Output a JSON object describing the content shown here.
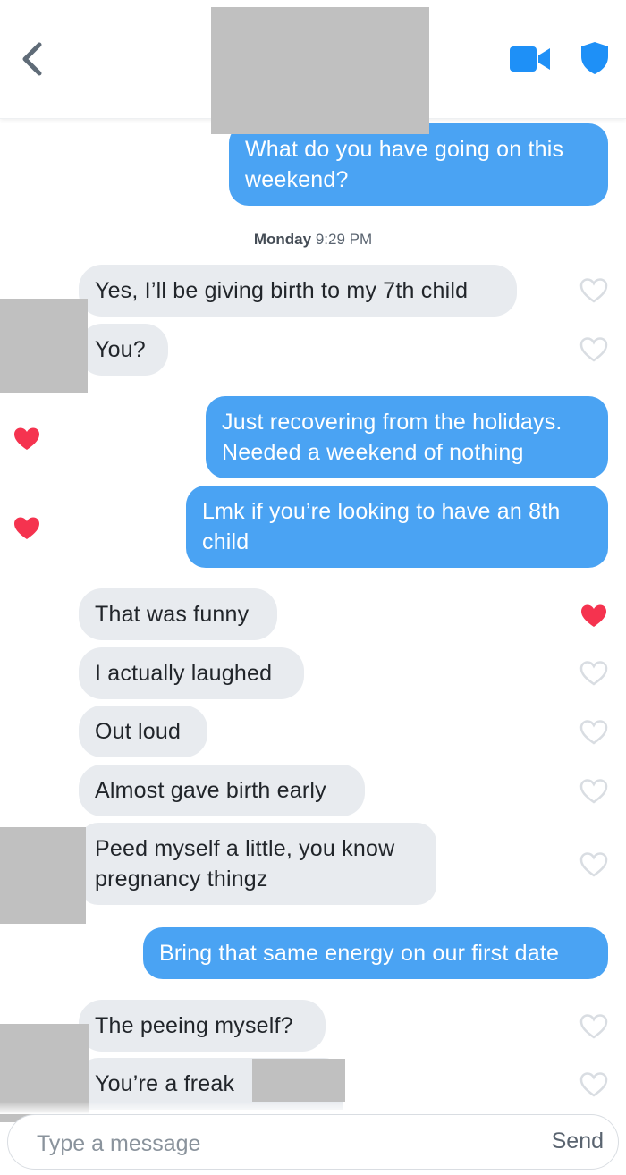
{
  "header": {
    "back_icon": "chevron-left-icon",
    "video_icon": "video-camera-icon",
    "safety_icon": "shield-icon",
    "accent_color": "#1e90f7"
  },
  "conversation": {
    "messages": [
      {
        "from": "me",
        "text": "What do you have going on this weekend?"
      },
      {
        "type": "timestamp",
        "day": "Monday",
        "time": "9:29 PM"
      },
      {
        "from": "them",
        "text": "Yes, I’ll be giving birth to my 7th child",
        "liked": false
      },
      {
        "from": "them",
        "text": "You?",
        "liked": false
      },
      {
        "from": "me",
        "text": "Just recovering from the holidays. Needed a weekend of nothing",
        "liked": true
      },
      {
        "from": "me",
        "text": "Lmk if you’re looking to have an 8th child",
        "liked": true
      },
      {
        "from": "them",
        "text": "That was funny",
        "liked": true
      },
      {
        "from": "them",
        "text": "I actually laughed",
        "liked": false
      },
      {
        "from": "them",
        "text": "Out loud",
        "liked": false
      },
      {
        "from": "them",
        "text": "Almost gave birth early",
        "liked": false
      },
      {
        "from": "them",
        "text": "Peed myself a little, you know pregnancy thingz",
        "liked": false
      },
      {
        "from": "me",
        "text": "Bring that same energy on our first date"
      },
      {
        "from": "them",
        "text": "The peeing myself?",
        "liked": false
      },
      {
        "from": "them",
        "text": "You’re a freak",
        "liked": false
      }
    ]
  },
  "composer": {
    "placeholder": "Type a message",
    "send_label": "Send"
  },
  "colors": {
    "outgoing_bubble": "#4aa3f3",
    "incoming_bubble": "#e8ebef",
    "heart_liked": "#f5334f",
    "heart_unliked": "#d9dde2"
  }
}
